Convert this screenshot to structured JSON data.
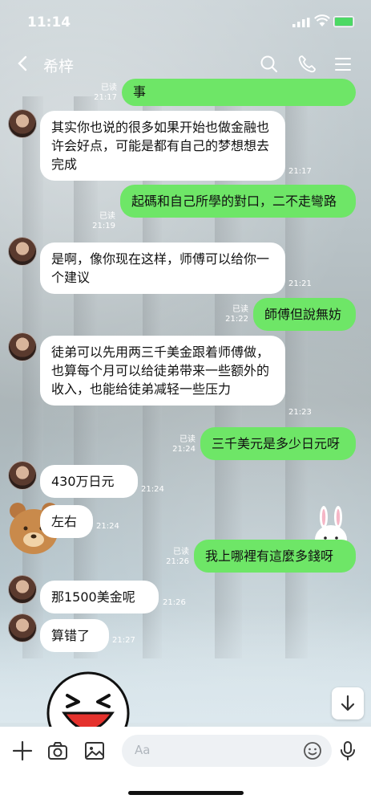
{
  "status_bar": {
    "time": "11:14"
  },
  "header": {
    "title": "希梓"
  },
  "messages": [
    {
      "text": "事",
      "read": "已读",
      "time": "21:17"
    },
    {
      "text": "其实你也说的很多如果开始也做金融也许会好点，可能是都有自己的梦想想去完成",
      "time": "21:17"
    },
    {
      "text": "起碼和自己所學的對口，二不走彎路",
      "read": "已读",
      "time": "21:19"
    },
    {
      "text": "是啊，像你现在这样，师傅可以给你一个建议",
      "time": "21:21"
    },
    {
      "text": "師傅但說無妨",
      "read": "已读",
      "time": "21:22"
    },
    {
      "text": "徒弟可以先用两三千美金跟着师傅做，也算每个月可以给徒弟带来一些额外的收入，也能给徒弟减轻一些压力",
      "time": "21:23"
    },
    {
      "text": "三千美元是多少日元呀",
      "read": "已读",
      "time": "21:24"
    },
    {
      "text": "430万日元",
      "time": "21:24"
    },
    {
      "text": "左右",
      "time": "21:24"
    },
    {
      "text": "我上哪裡有這麼多錢呀",
      "read": "已读",
      "time": "21:26"
    },
    {
      "text": "那1500美金呢",
      "time": "21:26"
    },
    {
      "text": "算错了",
      "time": "21:27"
    }
  ],
  "input": {
    "placeholder": "Aa"
  },
  "colors": {
    "outgoing": "#6ee667",
    "incoming": "#ffffff",
    "text": "#111111"
  },
  "icons": {
    "header": [
      "back-icon",
      "search-icon",
      "phone-icon",
      "menu-icon"
    ],
    "bottom": [
      "plus-icon",
      "camera-icon",
      "image-icon",
      "emoji-icon",
      "mic-icon"
    ]
  }
}
